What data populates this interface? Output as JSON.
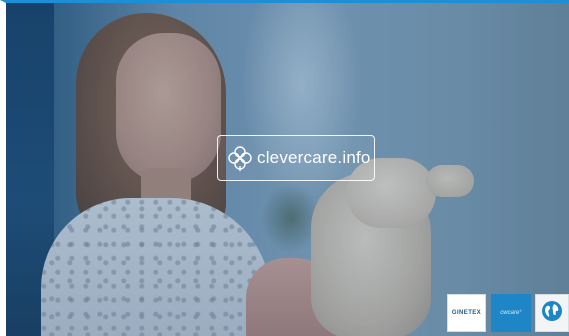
{
  "video": {
    "logo_text": "clevercare.info",
    "logo_icon": "clover-icon"
  },
  "tiles": {
    "ginetex_label": "GINETEX",
    "clevercare_label": "cwcare°",
    "globe_icon": "globe-icon"
  },
  "colors": {
    "accent_border": "#1d8fd6",
    "clevercare_tile": "#1e86c7",
    "ginetex_text": "#1c5a8c"
  }
}
